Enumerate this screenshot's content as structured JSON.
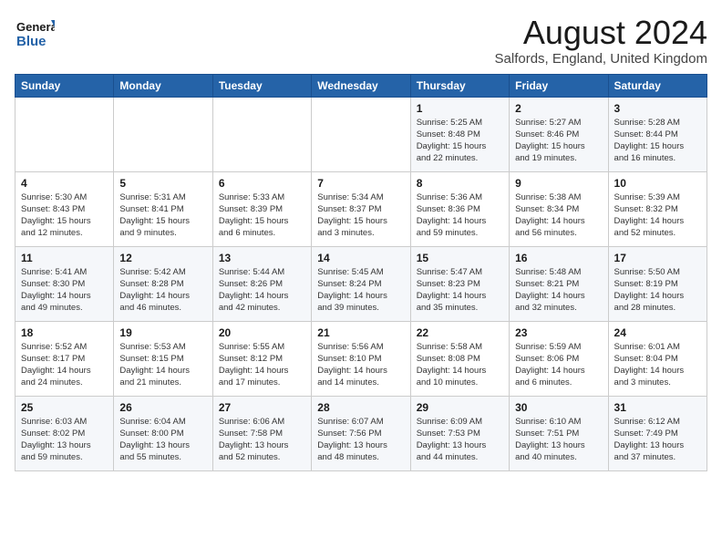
{
  "header": {
    "logo_line1": "General",
    "logo_line2": "Blue",
    "month": "August 2024",
    "location": "Salfords, England, United Kingdom"
  },
  "weekdays": [
    "Sunday",
    "Monday",
    "Tuesday",
    "Wednesday",
    "Thursday",
    "Friday",
    "Saturday"
  ],
  "weeks": [
    [
      {
        "day": "",
        "info": ""
      },
      {
        "day": "",
        "info": ""
      },
      {
        "day": "",
        "info": ""
      },
      {
        "day": "",
        "info": ""
      },
      {
        "day": "1",
        "info": "Sunrise: 5:25 AM\nSunset: 8:48 PM\nDaylight: 15 hours\nand 22 minutes."
      },
      {
        "day": "2",
        "info": "Sunrise: 5:27 AM\nSunset: 8:46 PM\nDaylight: 15 hours\nand 19 minutes."
      },
      {
        "day": "3",
        "info": "Sunrise: 5:28 AM\nSunset: 8:44 PM\nDaylight: 15 hours\nand 16 minutes."
      }
    ],
    [
      {
        "day": "4",
        "info": "Sunrise: 5:30 AM\nSunset: 8:43 PM\nDaylight: 15 hours\nand 12 minutes."
      },
      {
        "day": "5",
        "info": "Sunrise: 5:31 AM\nSunset: 8:41 PM\nDaylight: 15 hours\nand 9 minutes."
      },
      {
        "day": "6",
        "info": "Sunrise: 5:33 AM\nSunset: 8:39 PM\nDaylight: 15 hours\nand 6 minutes."
      },
      {
        "day": "7",
        "info": "Sunrise: 5:34 AM\nSunset: 8:37 PM\nDaylight: 15 hours\nand 3 minutes."
      },
      {
        "day": "8",
        "info": "Sunrise: 5:36 AM\nSunset: 8:36 PM\nDaylight: 14 hours\nand 59 minutes."
      },
      {
        "day": "9",
        "info": "Sunrise: 5:38 AM\nSunset: 8:34 PM\nDaylight: 14 hours\nand 56 minutes."
      },
      {
        "day": "10",
        "info": "Sunrise: 5:39 AM\nSunset: 8:32 PM\nDaylight: 14 hours\nand 52 minutes."
      }
    ],
    [
      {
        "day": "11",
        "info": "Sunrise: 5:41 AM\nSunset: 8:30 PM\nDaylight: 14 hours\nand 49 minutes."
      },
      {
        "day": "12",
        "info": "Sunrise: 5:42 AM\nSunset: 8:28 PM\nDaylight: 14 hours\nand 46 minutes."
      },
      {
        "day": "13",
        "info": "Sunrise: 5:44 AM\nSunset: 8:26 PM\nDaylight: 14 hours\nand 42 minutes."
      },
      {
        "day": "14",
        "info": "Sunrise: 5:45 AM\nSunset: 8:24 PM\nDaylight: 14 hours\nand 39 minutes."
      },
      {
        "day": "15",
        "info": "Sunrise: 5:47 AM\nSunset: 8:23 PM\nDaylight: 14 hours\nand 35 minutes."
      },
      {
        "day": "16",
        "info": "Sunrise: 5:48 AM\nSunset: 8:21 PM\nDaylight: 14 hours\nand 32 minutes."
      },
      {
        "day": "17",
        "info": "Sunrise: 5:50 AM\nSunset: 8:19 PM\nDaylight: 14 hours\nand 28 minutes."
      }
    ],
    [
      {
        "day": "18",
        "info": "Sunrise: 5:52 AM\nSunset: 8:17 PM\nDaylight: 14 hours\nand 24 minutes."
      },
      {
        "day": "19",
        "info": "Sunrise: 5:53 AM\nSunset: 8:15 PM\nDaylight: 14 hours\nand 21 minutes."
      },
      {
        "day": "20",
        "info": "Sunrise: 5:55 AM\nSunset: 8:12 PM\nDaylight: 14 hours\nand 17 minutes."
      },
      {
        "day": "21",
        "info": "Sunrise: 5:56 AM\nSunset: 8:10 PM\nDaylight: 14 hours\nand 14 minutes."
      },
      {
        "day": "22",
        "info": "Sunrise: 5:58 AM\nSunset: 8:08 PM\nDaylight: 14 hours\nand 10 minutes."
      },
      {
        "day": "23",
        "info": "Sunrise: 5:59 AM\nSunset: 8:06 PM\nDaylight: 14 hours\nand 6 minutes."
      },
      {
        "day": "24",
        "info": "Sunrise: 6:01 AM\nSunset: 8:04 PM\nDaylight: 14 hours\nand 3 minutes."
      }
    ],
    [
      {
        "day": "25",
        "info": "Sunrise: 6:03 AM\nSunset: 8:02 PM\nDaylight: 13 hours\nand 59 minutes."
      },
      {
        "day": "26",
        "info": "Sunrise: 6:04 AM\nSunset: 8:00 PM\nDaylight: 13 hours\nand 55 minutes."
      },
      {
        "day": "27",
        "info": "Sunrise: 6:06 AM\nSunset: 7:58 PM\nDaylight: 13 hours\nand 52 minutes."
      },
      {
        "day": "28",
        "info": "Sunrise: 6:07 AM\nSunset: 7:56 PM\nDaylight: 13 hours\nand 48 minutes."
      },
      {
        "day": "29",
        "info": "Sunrise: 6:09 AM\nSunset: 7:53 PM\nDaylight: 13 hours\nand 44 minutes."
      },
      {
        "day": "30",
        "info": "Sunrise: 6:10 AM\nSunset: 7:51 PM\nDaylight: 13 hours\nand 40 minutes."
      },
      {
        "day": "31",
        "info": "Sunrise: 6:12 AM\nSunset: 7:49 PM\nDaylight: 13 hours\nand 37 minutes."
      }
    ]
  ]
}
